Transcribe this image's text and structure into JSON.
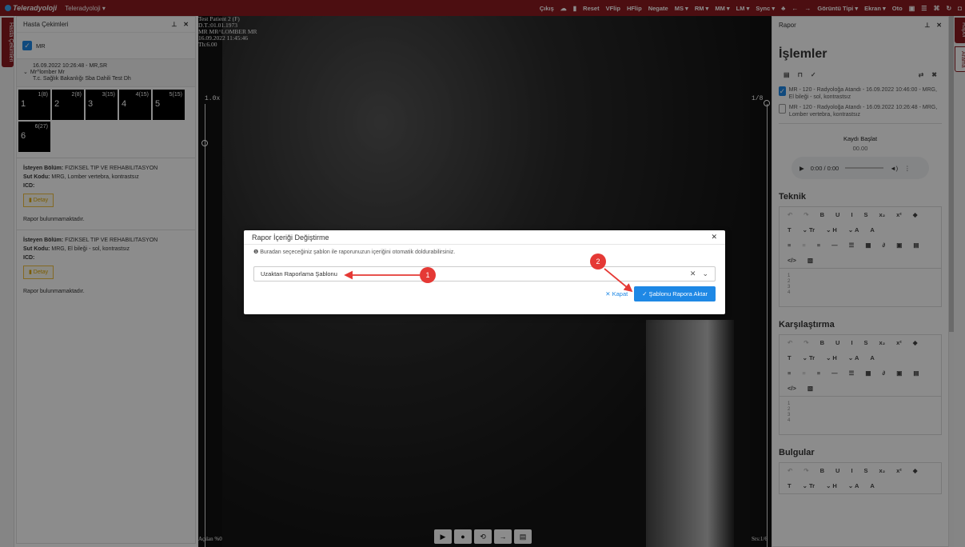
{
  "topbar": {
    "logo": "Teleradyoloji",
    "app_menu": "Teleradyoloji ▾",
    "tools": [
      "Çıkış",
      "Reset",
      "VFlip",
      "HFlip",
      "Negate",
      "MS ▾",
      "RM ▾",
      "MM ▾",
      "LM ▾",
      "Sync ▾",
      "Görüntü Tipi ▾",
      "Ekran ▾",
      "Oto"
    ]
  },
  "side_tabs": {
    "left": "Hasta Çekimleri",
    "right1": "Rapor",
    "right2": "Arama"
  },
  "left_panel": {
    "title": "Hasta Çekimleri",
    "modality": "MR",
    "study": {
      "line1": "16.09.2022 10:26:48 - MR,SR",
      "line2": "Mr^lomber Mr",
      "line3": "T.c. Sağlık Bakanlığı Sba Dahili Test Dh"
    },
    "thumbs": [
      {
        "n": "1",
        "c": "1(8)"
      },
      {
        "n": "2",
        "c": "2(8)"
      },
      {
        "n": "3",
        "c": "3(15)"
      },
      {
        "n": "4",
        "c": "4(15)"
      },
      {
        "n": "5",
        "c": "5(15)"
      },
      {
        "n": "6",
        "c": "6(27)"
      }
    ],
    "requests": [
      {
        "dept_label": "İsteyen Bölüm:",
        "dept": "FIZIKSEL TIP VE REHABILITASYON",
        "sut_label": "Sut Kodu:",
        "sut": "MRG, Lomber vertebra, kontrastsız",
        "icd_label": "ICD:",
        "detay": "Detay",
        "none": "Rapor bulunmamaktadır."
      },
      {
        "dept_label": "İsteyen Bölüm:",
        "dept": "FIZIKSEL TIP VE REHABILITASYON",
        "sut_label": "Sut Kodu:",
        "sut": "MRG, El bileği - sol, kontrastsız",
        "icd_label": "ICD:",
        "detay": "Detay",
        "none": "Rapor bulunmamaktadır."
      }
    ]
  },
  "viewer": {
    "overlay": [
      "Test Patient 2 (F)",
      "D.T.:01.01.1973",
      "MR MR^LOMBER MR",
      "16.09.2022 11:45:46",
      "Th:6.00"
    ],
    "zoom": "1.0x",
    "page": "1/8",
    "bottom_left": "Açılan %0",
    "bottom_right": "Srs:1/6"
  },
  "right_panel": {
    "title": "Rapor",
    "heading": "İşlemler",
    "ops": [
      {
        "checked": true,
        "text": "MR - 120 - Radyoloğa Atandı - 16.09.2022 10:46:00 - MRG, El bileği - sol, kontrastsız"
      },
      {
        "checked": false,
        "text": "MR - 120 - Radyoloğa Atandı - 16.09.2022 10:26:48 - MRG, Lomber vertebra, kontrastsız"
      }
    ],
    "record_label": "Kaydı Başlat",
    "record_time": "00.00",
    "audio_time": "0:00 / 0:00",
    "sections": [
      "Teknik",
      "Karşılaştırma",
      "Bulgular"
    ],
    "editor_lines": [
      "1",
      "2",
      "3",
      "4"
    ]
  },
  "modal": {
    "title": "Rapor İçeriği Değiştirme",
    "hint": "Buradan seçeceğiniz şablon ile raporunuzun içeriğini otomatik doldurabilirsiniz.",
    "select_value": "Uzaktan Raporlama Şablonu",
    "close_label": "Kapat",
    "apply_label": "Şablonu Rapora Aktar"
  },
  "annotations": {
    "step1": "1",
    "step2": "2",
    "color": "#e53935"
  }
}
